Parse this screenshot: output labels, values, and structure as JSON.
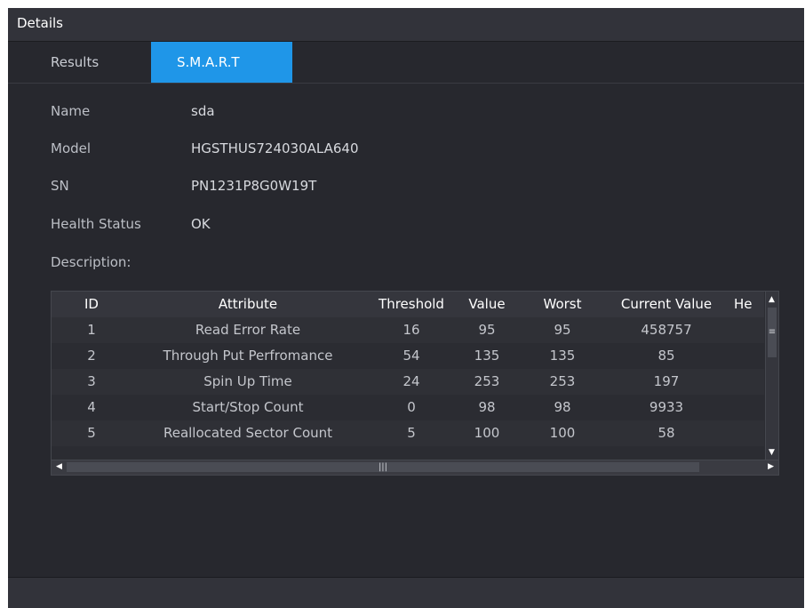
{
  "window": {
    "title": "Details"
  },
  "tabs": [
    {
      "label": "Results",
      "active": false
    },
    {
      "label": "S.M.A.R.T",
      "active": true
    }
  ],
  "info": {
    "name_label": "Name",
    "name_value": "sda",
    "model_label": "Model",
    "model_value": "HGSTHUS724030ALA640",
    "sn_label": "SN",
    "sn_value": "PN1231P8G0W19T",
    "health_label": "Health Status",
    "health_value": "OK",
    "description_label": "Description:"
  },
  "table": {
    "columns": [
      "ID",
      "Attribute",
      "Threshold",
      "Value",
      "Worst",
      "Current Value",
      "He"
    ],
    "rows": [
      [
        "1",
        "Read Error Rate",
        "16",
        "95",
        "95",
        "458757"
      ],
      [
        "2",
        "Through Put Perfromance",
        "54",
        "135",
        "135",
        "85"
      ],
      [
        "3",
        "Spin Up Time",
        "24",
        "253",
        "253",
        "197"
      ],
      [
        "4",
        "Start/Stop Count",
        "0",
        "98",
        "98",
        "9933"
      ],
      [
        "5",
        "Reallocated Sector Count",
        "5",
        "100",
        "100",
        "58"
      ]
    ]
  },
  "colors": {
    "accent": "#1f96e8",
    "background": "#27282e",
    "titlebar": "#32333a"
  },
  "icons": {
    "scroll_up": "up-arrow-icon",
    "scroll_down": "down-arrow-icon",
    "scroll_left": "left-arrow-icon",
    "scroll_right": "right-arrow-icon",
    "grip": "grip-icon"
  }
}
